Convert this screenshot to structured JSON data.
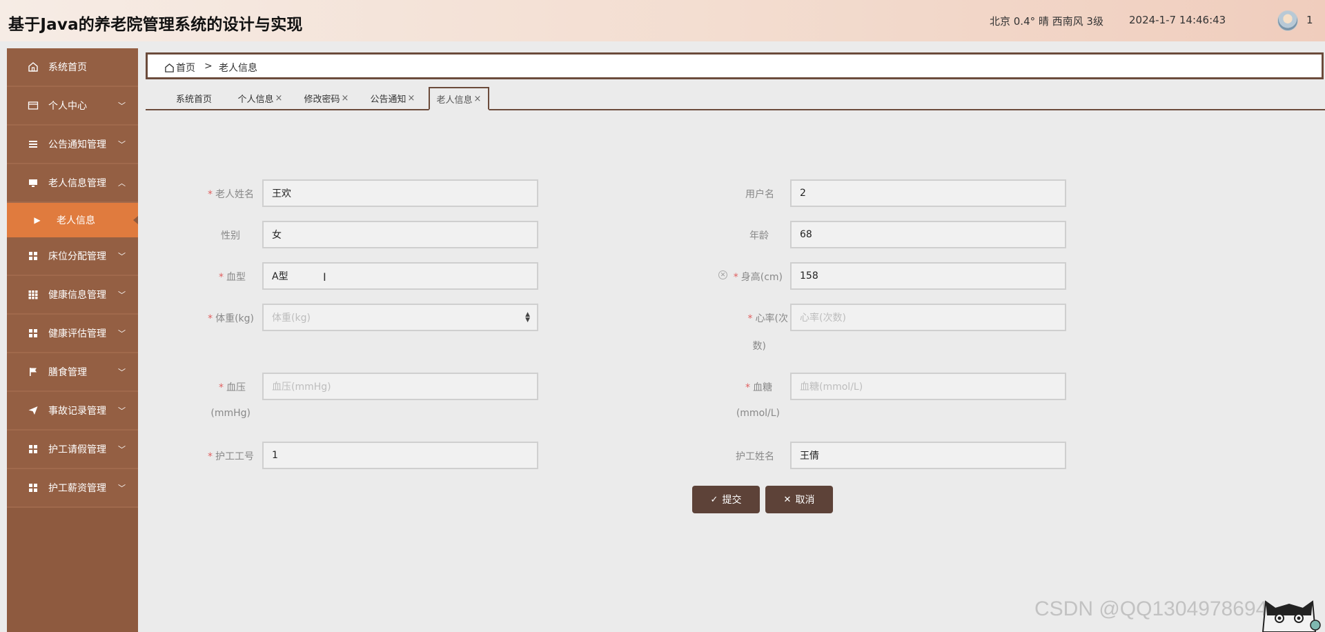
{
  "header": {
    "title": "基于Java的养老院管理系统的设计与实现",
    "weather": "北京  0.4°  晴  西南风  3级",
    "datetime": "2024-1-7 14:46:43",
    "user": "1"
  },
  "sidebar": {
    "items": [
      {
        "label": "系统首页",
        "icon": "home-icon"
      },
      {
        "label": "个人中心",
        "icon": "card-icon"
      },
      {
        "label": "公告通知管理",
        "icon": "list-icon"
      },
      {
        "label": "老人信息管理",
        "icon": "monitor-icon"
      },
      {
        "label": "老人信息",
        "icon": "caret-right-icon"
      },
      {
        "label": "床位分配管理",
        "icon": "grid-icon"
      },
      {
        "label": "健康信息管理",
        "icon": "table-icon"
      },
      {
        "label": "健康评估管理",
        "icon": "grid-icon"
      },
      {
        "label": "膳食管理",
        "icon": "flag-icon"
      },
      {
        "label": "事故记录管理",
        "icon": "send-icon"
      },
      {
        "label": "护工请假管理",
        "icon": "grid-icon"
      },
      {
        "label": "护工薪资管理",
        "icon": "grid-icon"
      }
    ]
  },
  "breadcrumb": {
    "home": "首页",
    "separator": ">",
    "current": "老人信息"
  },
  "tabs": [
    {
      "label": "系统首页",
      "closable": false
    },
    {
      "label": "个人信息",
      "closable": true
    },
    {
      "label": "修改密码",
      "closable": true
    },
    {
      "label": "公告通知",
      "closable": true
    },
    {
      "label": "老人信息",
      "closable": true
    }
  ],
  "tab_close": "×",
  "form": {
    "elder_name": {
      "label": "老人姓名",
      "value": "王欢"
    },
    "username": {
      "label": "用户名",
      "value": "2"
    },
    "gender": {
      "label": "性别",
      "value": "女"
    },
    "age": {
      "label": "年龄",
      "value": "68"
    },
    "blood_type": {
      "label": "血型",
      "value": "A型"
    },
    "height": {
      "label": "身高(cm)",
      "value": "158"
    },
    "weight": {
      "label": "体重(kg)",
      "placeholder": "体重(kg)"
    },
    "heart_rate": {
      "label_line1": "心率(次",
      "label_line2": "数)",
      "placeholder": "心率(次数)"
    },
    "blood_pressure": {
      "label_line1": "血压",
      "label_line2": "(mmHg)",
      "placeholder": "血压(mmHg)"
    },
    "blood_sugar": {
      "label_line1": "血糖",
      "label_line2": "(mmol/L)",
      "placeholder": "血糖(mmol/L)"
    },
    "nurse_id": {
      "label": "护工工号",
      "value": "1"
    },
    "nurse_name": {
      "label": "护工姓名",
      "value": "王倩"
    },
    "required_mark": "*",
    "submit": "提交",
    "cancel": "取消"
  },
  "watermark": "CSDN @QQ1304978694",
  "colors": {
    "sidebar": "#8e5a3f",
    "active": "#e07b3e",
    "button": "#5d4238"
  }
}
